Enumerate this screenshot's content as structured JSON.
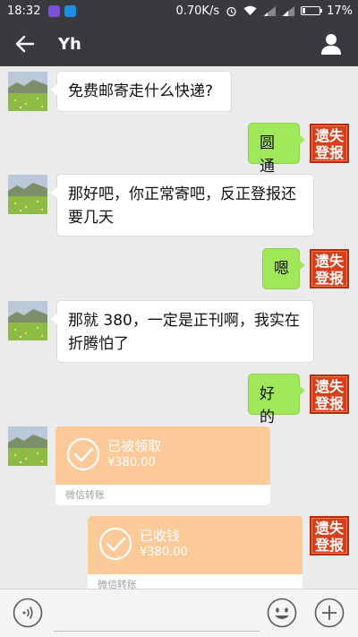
{
  "status_bar": {
    "time": "18:32",
    "network_speed": "0.70K/s",
    "battery_percent": "17%",
    "battery_level": 0.17,
    "app_icons": [
      "purple-app-icon",
      "blue-app-icon"
    ]
  },
  "header": {
    "title": "Yh",
    "back_icon": "arrow-left-icon",
    "profile_icon": "person-icon"
  },
  "messages": [
    {
      "side": "in",
      "type": "text",
      "text": "免费邮寄走什么快递?"
    },
    {
      "side": "out",
      "type": "text",
      "text": "圆通",
      "stamp": [
        "遗失",
        "登报"
      ]
    },
    {
      "side": "in",
      "type": "text",
      "text": "那好吧，你正常寄吧，反正登报还要几天"
    },
    {
      "side": "out",
      "type": "text",
      "text": "嗯",
      "stamp": [
        "遗失",
        "登报"
      ]
    },
    {
      "side": "in",
      "type": "text",
      "text": "那就 380，一定是正刊啊，我实在折腾怕了"
    },
    {
      "side": "out",
      "type": "text",
      "text": "好的",
      "stamp": [
        "遗失",
        "登报"
      ]
    },
    {
      "side": "in",
      "type": "transfer",
      "status": "已被领取",
      "amount": "¥380.00",
      "footer": "微信转账"
    },
    {
      "side": "out",
      "type": "transfer",
      "status": "已收钱",
      "amount": "¥380.00",
      "footer": "微信转账",
      "stamp": [
        "遗失",
        "登报"
      ]
    }
  ],
  "input_bar": {
    "voice_icon": "voice-icon",
    "emoji_icon": "emoji-icon",
    "plus_icon": "plus-icon",
    "placeholder": ""
  },
  "colors": {
    "bar": "#393a3f",
    "chat_bg": "#ebebeb",
    "out_bubble": "#a0e75a",
    "transfer": "#fcc999",
    "stamp": "#d8401d"
  }
}
